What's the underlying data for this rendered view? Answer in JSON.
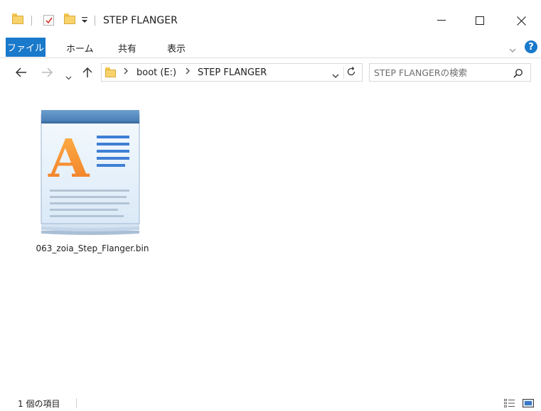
{
  "window": {
    "title": "STEP FLANGER"
  },
  "quick_access": {
    "items": [
      "folder-icon",
      "properties-check-icon",
      "new-folder-icon",
      "customize-dropdown-icon"
    ]
  },
  "ribbon": {
    "tabs": [
      {
        "label": "ファイル",
        "active": true
      },
      {
        "label": "ホーム"
      },
      {
        "label": "共有"
      },
      {
        "label": "表示"
      }
    ],
    "help_label": "?"
  },
  "navigation": {
    "breadcrumb": [
      "boot (E:)",
      "STEP FLANGER"
    ]
  },
  "search": {
    "placeholder": "STEP FLANGERの検索"
  },
  "content": {
    "items": [
      {
        "name": "063_zoia_Step_Flanger.bin",
        "icon": "wordpad-document-icon"
      }
    ]
  },
  "status_bar": {
    "item_count": "1 個の項目"
  },
  "colors": {
    "accent": "#1979ca",
    "folder": "#f8d36b",
    "wordpad_letter": "#f28a2e"
  }
}
